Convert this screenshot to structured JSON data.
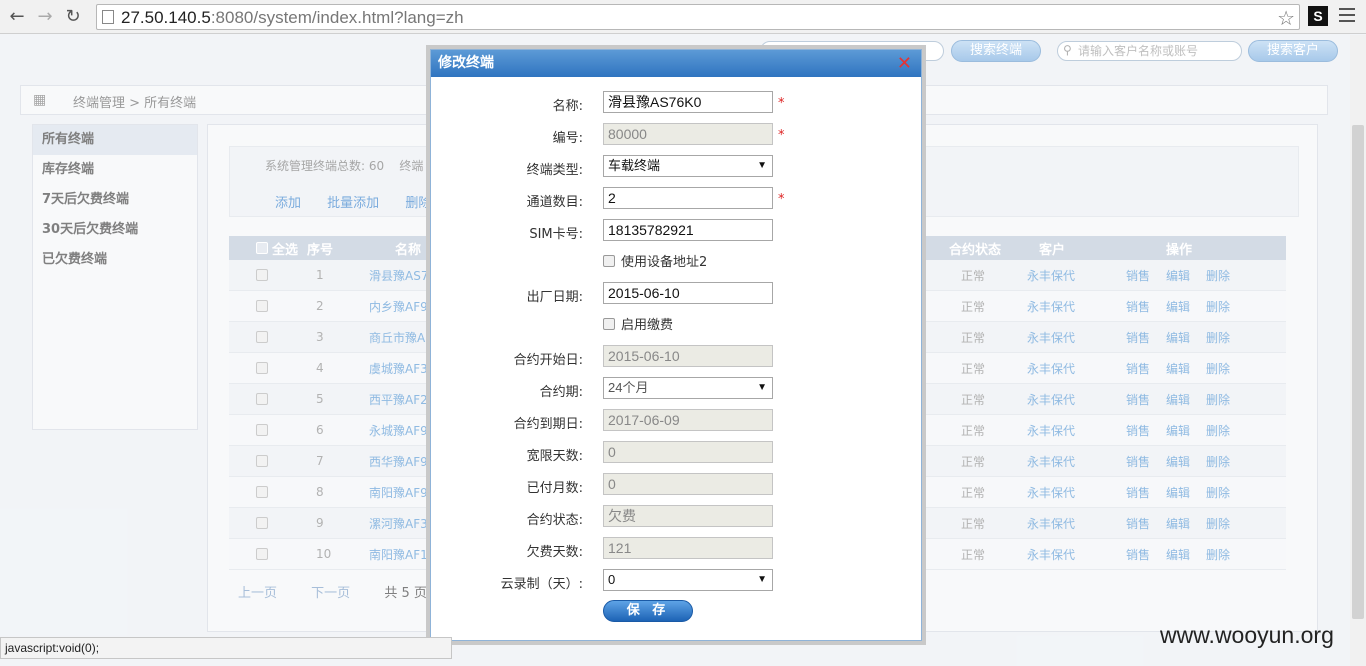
{
  "browser": {
    "url_host": "27.50.140.5",
    "url_rest": ":8080/system/index.html?lang=zh",
    "ext_label": "S"
  },
  "top": {
    "search1_btn": "搜索终端",
    "search2_placeholder": "请输入客户名称或账号",
    "search2_btn": "搜索客户"
  },
  "breadcrumb": "终端管理 > 所有终端",
  "sidebar": {
    "items": [
      {
        "label": "所有终端"
      },
      {
        "label": "库存终端"
      },
      {
        "label": "7天后欠费终端"
      },
      {
        "label": "30天后欠费终端"
      },
      {
        "label": "已欠费终端"
      }
    ]
  },
  "stats": {
    "total_text": "系统管理终端总数: 60",
    "trailing": "终端",
    "actions": {
      "add": "添加",
      "batch_add": "批量添加",
      "delete": "删除"
    }
  },
  "table": {
    "headers": {
      "select_all": "全选",
      "index": "序号",
      "name": "名称",
      "contract_status": "合约状态",
      "customer": "客户",
      "operation": "操作"
    },
    "rows": [
      {
        "index": "1",
        "name": "滑县豫AS76",
        "status": "正常",
        "customer": "永丰保代"
      },
      {
        "index": "2",
        "name": "内乡豫AF95",
        "status": "正常",
        "customer": "永丰保代"
      },
      {
        "index": "3",
        "name": "商丘市豫AF8",
        "status": "正常",
        "customer": "永丰保代"
      },
      {
        "index": "4",
        "name": "虞城豫AF30",
        "status": "正常",
        "customer": "永丰保代"
      },
      {
        "index": "5",
        "name": "西平豫AF27",
        "status": "正常",
        "customer": "永丰保代"
      },
      {
        "index": "6",
        "name": "永城豫AF96",
        "status": "正常",
        "customer": "永丰保代"
      },
      {
        "index": "7",
        "name": "西华豫AF96",
        "status": "正常",
        "customer": "永丰保代"
      },
      {
        "index": "8",
        "name": "南阳豫AF95",
        "status": "正常",
        "customer": "永丰保代"
      },
      {
        "index": "9",
        "name": "漯河豫AF35",
        "status": "正常",
        "customer": "永丰保代"
      },
      {
        "index": "10",
        "name": "南阳豫AF17",
        "status": "正常",
        "customer": "永丰保代"
      }
    ],
    "row_actions": {
      "sell": "销售",
      "edit": "编辑",
      "delete": "删除"
    }
  },
  "pager": {
    "prev": "上一页",
    "next": "下一页",
    "total": "共 5 页"
  },
  "dialog": {
    "title": "修改终端",
    "close_glyph": "✕",
    "fields": {
      "name": {
        "label": "名称:",
        "value": "滑县豫AS76K0"
      },
      "number": {
        "label": "编号:",
        "value": "80000"
      },
      "type": {
        "label": "终端类型:",
        "value": "车载终端"
      },
      "channels": {
        "label": "通道数目:",
        "value": "2"
      },
      "sim": {
        "label": "SIM卡号:",
        "value": "18135782921"
      },
      "use_addr2": {
        "label": "使用设备地址2"
      },
      "factory_date": {
        "label": "出厂日期:",
        "value": "2015-06-10"
      },
      "enable_fee": {
        "label": "启用缴费"
      },
      "contract_start": {
        "label": "合约开始日:",
        "value": "2015-06-10"
      },
      "contract_period": {
        "label": "合约期:",
        "value": "24个月"
      },
      "contract_end": {
        "label": "合约到期日:",
        "value": "2017-06-09"
      },
      "grace_days": {
        "label": "宽限天数:",
        "value": "0"
      },
      "paid_months": {
        "label": "已付月数:",
        "value": "0"
      },
      "contract_status": {
        "label": "合约状态:",
        "value": "欠费"
      },
      "overdue_days": {
        "label": "欠费天数:",
        "value": "121"
      },
      "cloud_record": {
        "label": "云录制（天）:",
        "value": "0"
      }
    },
    "required_mark": "*",
    "save_label": "保 存"
  },
  "status_bar": "javascript:void(0);",
  "watermark": "www.wooyun.org",
  "colors": {
    "title_bar": "#2f74c0",
    "link": "#6aa3d9",
    "required": "#dd2222"
  }
}
